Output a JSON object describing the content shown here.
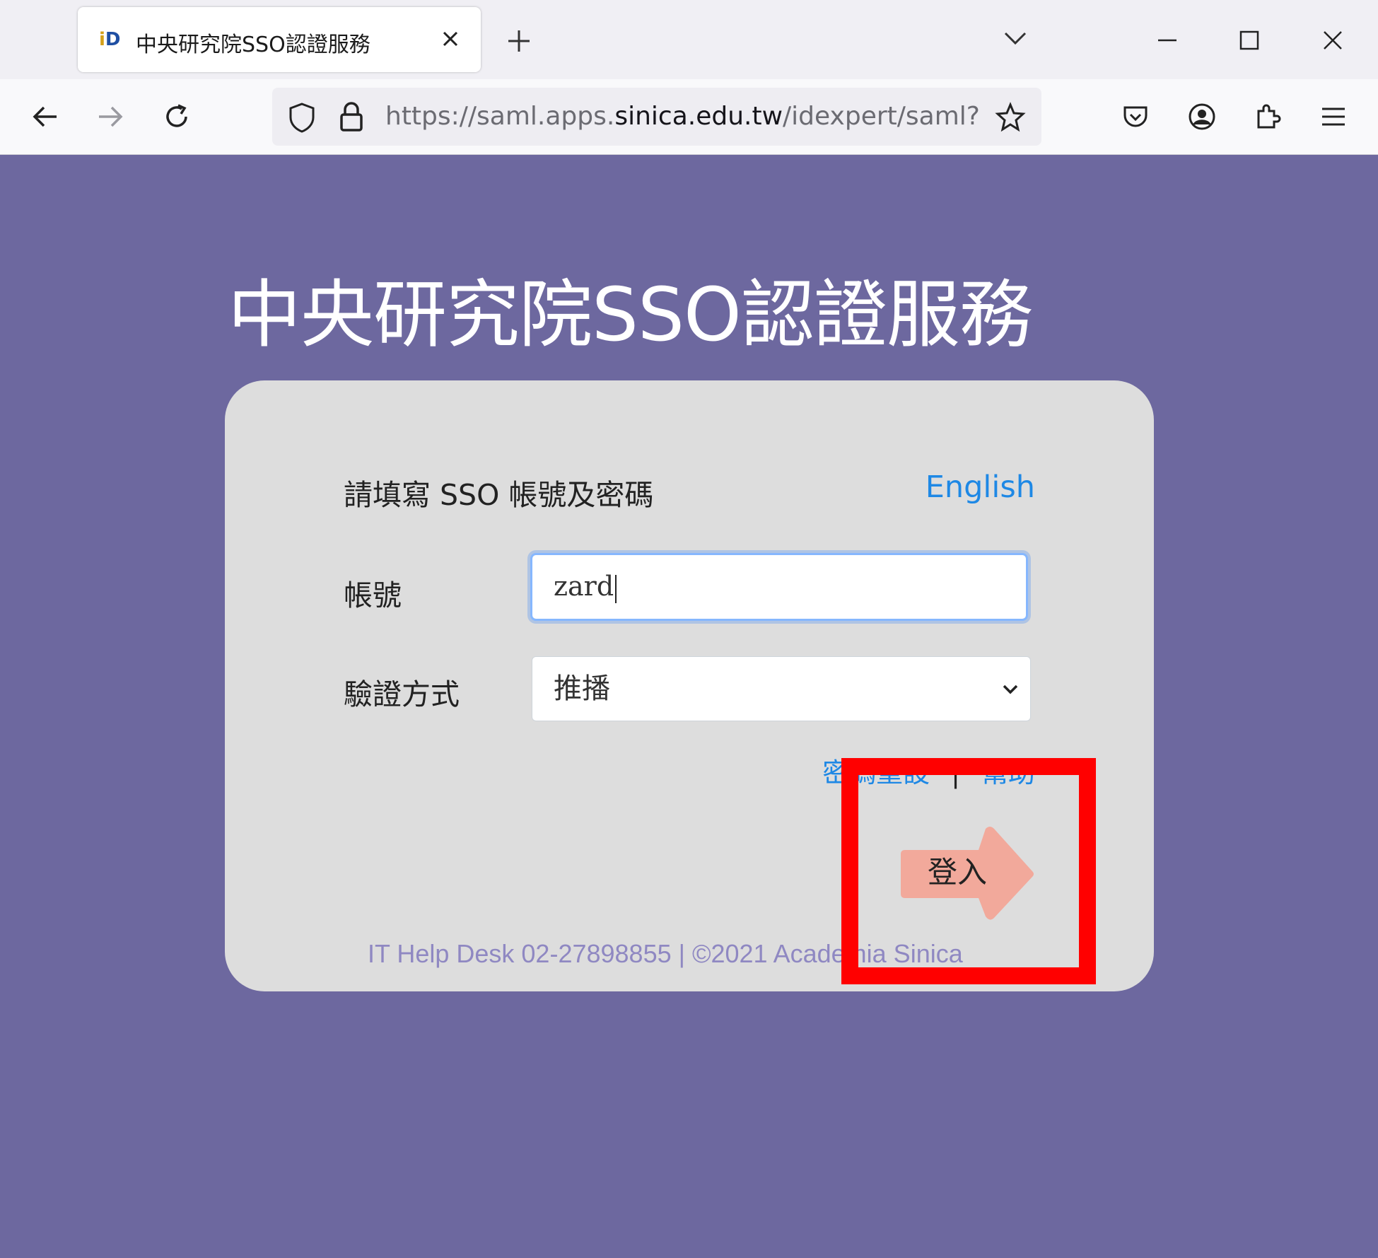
{
  "browser": {
    "tab_title": "中央研究院SSO認證服務",
    "url_prefix": "https://saml.apps.",
    "url_host": "sinica.edu.tw",
    "url_path": "/idexpert/saml?SAM"
  },
  "page": {
    "title": "中央研究院SSO認證服務",
    "prompt": "請填寫 SSO 帳號及密碼",
    "language_link": "English",
    "account_label": "帳號",
    "account_value": "zard",
    "method_label": "驗證方式",
    "method_value": "推播",
    "links": {
      "reset_password": "密碼重設",
      "separator": "|",
      "help": "幫助"
    },
    "login_button": "登入",
    "footer": "IT Help Desk 02-27898855  |  ©2021 Academia Sinica"
  },
  "colors": {
    "background": "#6d689f",
    "card": "#dddddd",
    "link": "#1e88e5",
    "login_arrow": "#f2a99b",
    "highlight": "#ff0000"
  }
}
